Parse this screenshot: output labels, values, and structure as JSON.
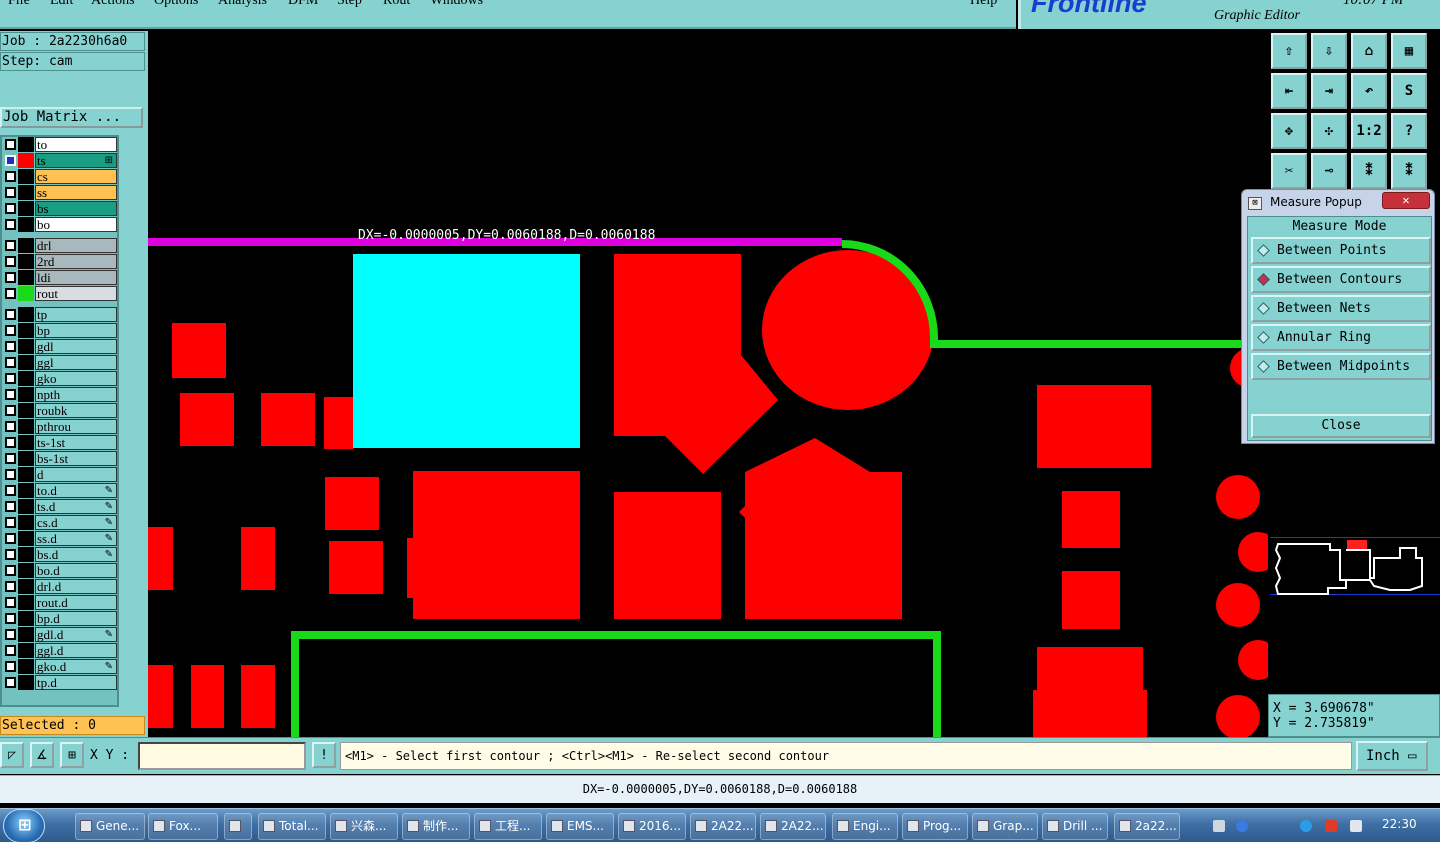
{
  "menubar": {
    "items": [
      "File",
      "Edit",
      "Actions",
      "Options",
      "Analysis",
      "DFM",
      "Step",
      "Rout",
      "Windows"
    ],
    "help": "Help"
  },
  "brand": {
    "logo": "Frontline",
    "subtitle": "Graphic Editor",
    "time": "10:07 PM"
  },
  "job": {
    "job_line": "Job : 2a2230h6a0",
    "step_line": "Step: cam",
    "matrix_button": "Job Matrix ..."
  },
  "layers": [
    {
      "name": "to",
      "color": "#ffffff",
      "swatch": "#000000",
      "checked": false
    },
    {
      "name": "ts",
      "color": "#199e83",
      "swatch": "#ff0000",
      "checked": true,
      "mark": "⊞"
    },
    {
      "name": "cs",
      "color": "#ffc152",
      "swatch": "#000000",
      "checked": false
    },
    {
      "name": "ss",
      "color": "#ffc152",
      "swatch": "#000000",
      "checked": false
    },
    {
      "name": "bs",
      "color": "#199e83",
      "swatch": "#000000",
      "checked": false
    },
    {
      "name": "bo",
      "color": "#ffffff",
      "swatch": "#000000",
      "checked": false
    },
    {
      "name": "drl",
      "color": "#a9b8bd",
      "swatch": "#000000",
      "checked": false
    },
    {
      "name": "2rd",
      "color": "#a9b8bd",
      "swatch": "#000000",
      "checked": false
    },
    {
      "name": "ldi",
      "color": "#a9b8bd",
      "swatch": "#000000",
      "checked": false
    },
    {
      "name": "rout",
      "color": "#d7dde0",
      "swatch": "#19d919",
      "checked": false
    },
    {
      "name": "tp",
      "color": "#86d2d0",
      "swatch": "#000000",
      "checked": false
    },
    {
      "name": "bp",
      "color": "#86d2d0",
      "swatch": "#000000",
      "checked": false
    },
    {
      "name": "gdl",
      "color": "#86d2d0",
      "swatch": "#000000",
      "checked": false
    },
    {
      "name": "ggl",
      "color": "#86d2d0",
      "swatch": "#000000",
      "checked": false
    },
    {
      "name": "gko",
      "color": "#86d2d0",
      "swatch": "#000000",
      "checked": false
    },
    {
      "name": "npth",
      "color": "#86d2d0",
      "swatch": "#000000",
      "checked": false
    },
    {
      "name": "roubk",
      "color": "#86d2d0",
      "swatch": "#000000",
      "checked": false
    },
    {
      "name": "pthrou",
      "color": "#86d2d0",
      "swatch": "#000000",
      "checked": false
    },
    {
      "name": "ts-1st",
      "color": "#86d2d0",
      "swatch": "#000000",
      "checked": false
    },
    {
      "name": "bs-1st",
      "color": "#86d2d0",
      "swatch": "#000000",
      "checked": false
    },
    {
      "name": "d",
      "color": "#86d2d0",
      "swatch": "#000000",
      "checked": false
    },
    {
      "name": "to.d",
      "color": "#86d2d0",
      "swatch": "#000000",
      "checked": false,
      "mark": "✎"
    },
    {
      "name": "ts.d",
      "color": "#86d2d0",
      "swatch": "#000000",
      "checked": false,
      "mark": "✎"
    },
    {
      "name": "cs.d",
      "color": "#86d2d0",
      "swatch": "#000000",
      "checked": false,
      "mark": "✎"
    },
    {
      "name": "ss.d",
      "color": "#86d2d0",
      "swatch": "#000000",
      "checked": false,
      "mark": "✎"
    },
    {
      "name": "bs.d",
      "color": "#86d2d0",
      "swatch": "#000000",
      "checked": false,
      "mark": "✎"
    },
    {
      "name": "bo.d",
      "color": "#86d2d0",
      "swatch": "#000000",
      "checked": false
    },
    {
      "name": "drl.d",
      "color": "#86d2d0",
      "swatch": "#000000",
      "checked": false
    },
    {
      "name": "rout.d",
      "color": "#86d2d0",
      "swatch": "#000000",
      "checked": false
    },
    {
      "name": "bp.d",
      "color": "#86d2d0",
      "swatch": "#000000",
      "checked": false
    },
    {
      "name": "gdl.d",
      "color": "#86d2d0",
      "swatch": "#000000",
      "checked": false,
      "mark": "✎"
    },
    {
      "name": "ggl.d",
      "color": "#86d2d0",
      "swatch": "#000000",
      "checked": false
    },
    {
      "name": "gko.d",
      "color": "#86d2d0",
      "swatch": "#000000",
      "checked": false,
      "mark": "✎"
    },
    {
      "name": "tp.d",
      "color": "#86d2d0",
      "swatch": "#000000",
      "checked": false
    }
  ],
  "selected": "Selected : 0",
  "canvas": {
    "measure_label": "DX=-0.0000005,DY=0.0060188,D=0.0060188"
  },
  "tools": [
    "⇧",
    "⇩",
    "⌂",
    "▦",
    "⇤",
    "⇥",
    "↶",
    "S",
    "✥",
    "✣",
    "1:2",
    "?",
    "✂",
    "⊸",
    "⁑",
    "⁑"
  ],
  "coords": {
    "x": "X = 3.690678\"",
    "y": "Y = 2.735819\""
  },
  "popup": {
    "title": "Measure Popup",
    "close_x": "✕",
    "mode_title": "Measure Mode",
    "modes": [
      {
        "label": "Between Points",
        "selected": false
      },
      {
        "label": "Between Contours",
        "selected": true
      },
      {
        "label": "Between Nets",
        "selected": false
      },
      {
        "label": "Annular Ring",
        "selected": false
      },
      {
        "label": "Between Midpoints",
        "selected": false
      }
    ],
    "close_label": "Close"
  },
  "command": {
    "xy_label": "X Y :",
    "xy_value": "",
    "bang": "!",
    "prompt": "<M1> - Select first contour ; <Ctrl><M1> - Re-select second contour",
    "unit": "Inch ▭"
  },
  "status": "DX=-0.0000005,DY=0.0060188,D=0.0060188",
  "taskbar": {
    "start": "⊞",
    "tasks": [
      "Gene...",
      "Fox...",
      "",
      "Total...",
      "兴森...",
      "制作...",
      "工程...",
      "EMS...",
      "2016...",
      "2A22...",
      "2A22...",
      "Engi...",
      "Prog...",
      "Grap...",
      "Drill ...",
      "2a22..."
    ],
    "clock": "22:30"
  },
  "colors": {
    "accent": "#86d2d0",
    "pad": "#ff0000",
    "rout": "#19d919",
    "highlight": "#00ffff",
    "measure": "#e000e0"
  }
}
